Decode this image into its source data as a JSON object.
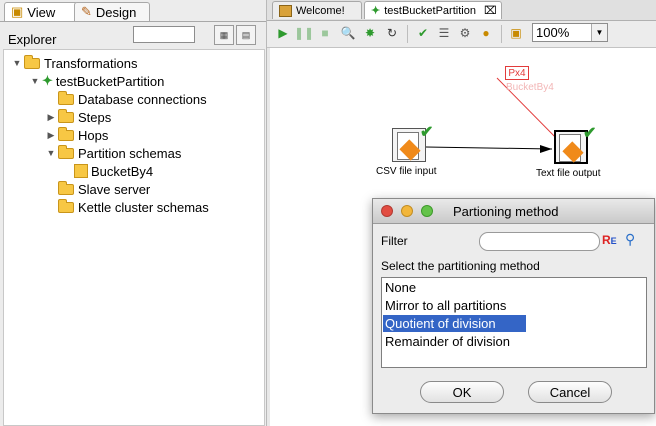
{
  "left_tabs": {
    "view": "View",
    "design": "Design"
  },
  "explorer": {
    "label": "Explorer",
    "filter_value": ""
  },
  "tree": [
    {
      "label": "Transformations"
    },
    {
      "label": "testBucketPartition"
    },
    {
      "label": "Database connections"
    },
    {
      "label": "Steps"
    },
    {
      "label": "Hops"
    },
    {
      "label": "Partition schemas"
    },
    {
      "label": "BucketBy4"
    },
    {
      "label": "Slave server"
    },
    {
      "label": "Kettle cluster schemas"
    }
  ],
  "editor_tabs": {
    "welcome": "Welcome!",
    "active": "testBucketPartition"
  },
  "zoom": {
    "value": "100%"
  },
  "canvas": {
    "partition_badge": "Px4",
    "partition_name": "BucketBy4",
    "step_csv": "CSV file input",
    "step_text": "Text file output"
  },
  "dialog": {
    "title": "Partioning method",
    "filter_label": "Filter",
    "filter_value": "",
    "prompt": "Select the partitioning method",
    "options": [
      "None",
      "Mirror to all partitions",
      "Quotient of division",
      "Remainder of division"
    ],
    "selected": "Quotient of division",
    "ok": "OK",
    "cancel": "Cancel"
  },
  "colors": {
    "selection": "#3465c6",
    "check": "#2e9a2e",
    "partition_red": "#e23b3b"
  },
  "icons": [
    "view-icon",
    "design-pencil-icon",
    "run-icon",
    "pause-icon",
    "stop-icon",
    "preview-icon",
    "debug-icon",
    "replay-icon",
    "verify-icon",
    "impact-icon",
    "sql-icon",
    "explore-db-icon",
    "show-results-icon",
    "regex-icon",
    "search-icon"
  ]
}
